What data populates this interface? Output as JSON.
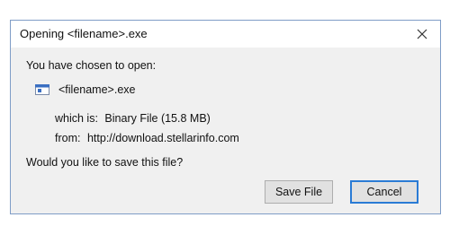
{
  "dialog": {
    "title": "Opening <filename>.exe",
    "close_icon": "close-icon",
    "prompt": "You have chosen to open:",
    "file": {
      "icon": "executable-file-icon",
      "name": "<filename>.exe"
    },
    "which_is_label": "which is:",
    "which_is_value": "Binary File (15.8 MB)",
    "from_label": "from:",
    "from_value": "http://download.stellarinfo.com",
    "question": "Would you like to save this file?",
    "buttons": {
      "save_label": "Save File",
      "cancel_label": "Cancel"
    }
  },
  "colors": {
    "border": "#7f9dc7",
    "background": "#f0f0f0",
    "titlebar": "#ffffff",
    "focus_border": "#2a7bd5",
    "button_bg": "#e1e1e1"
  }
}
